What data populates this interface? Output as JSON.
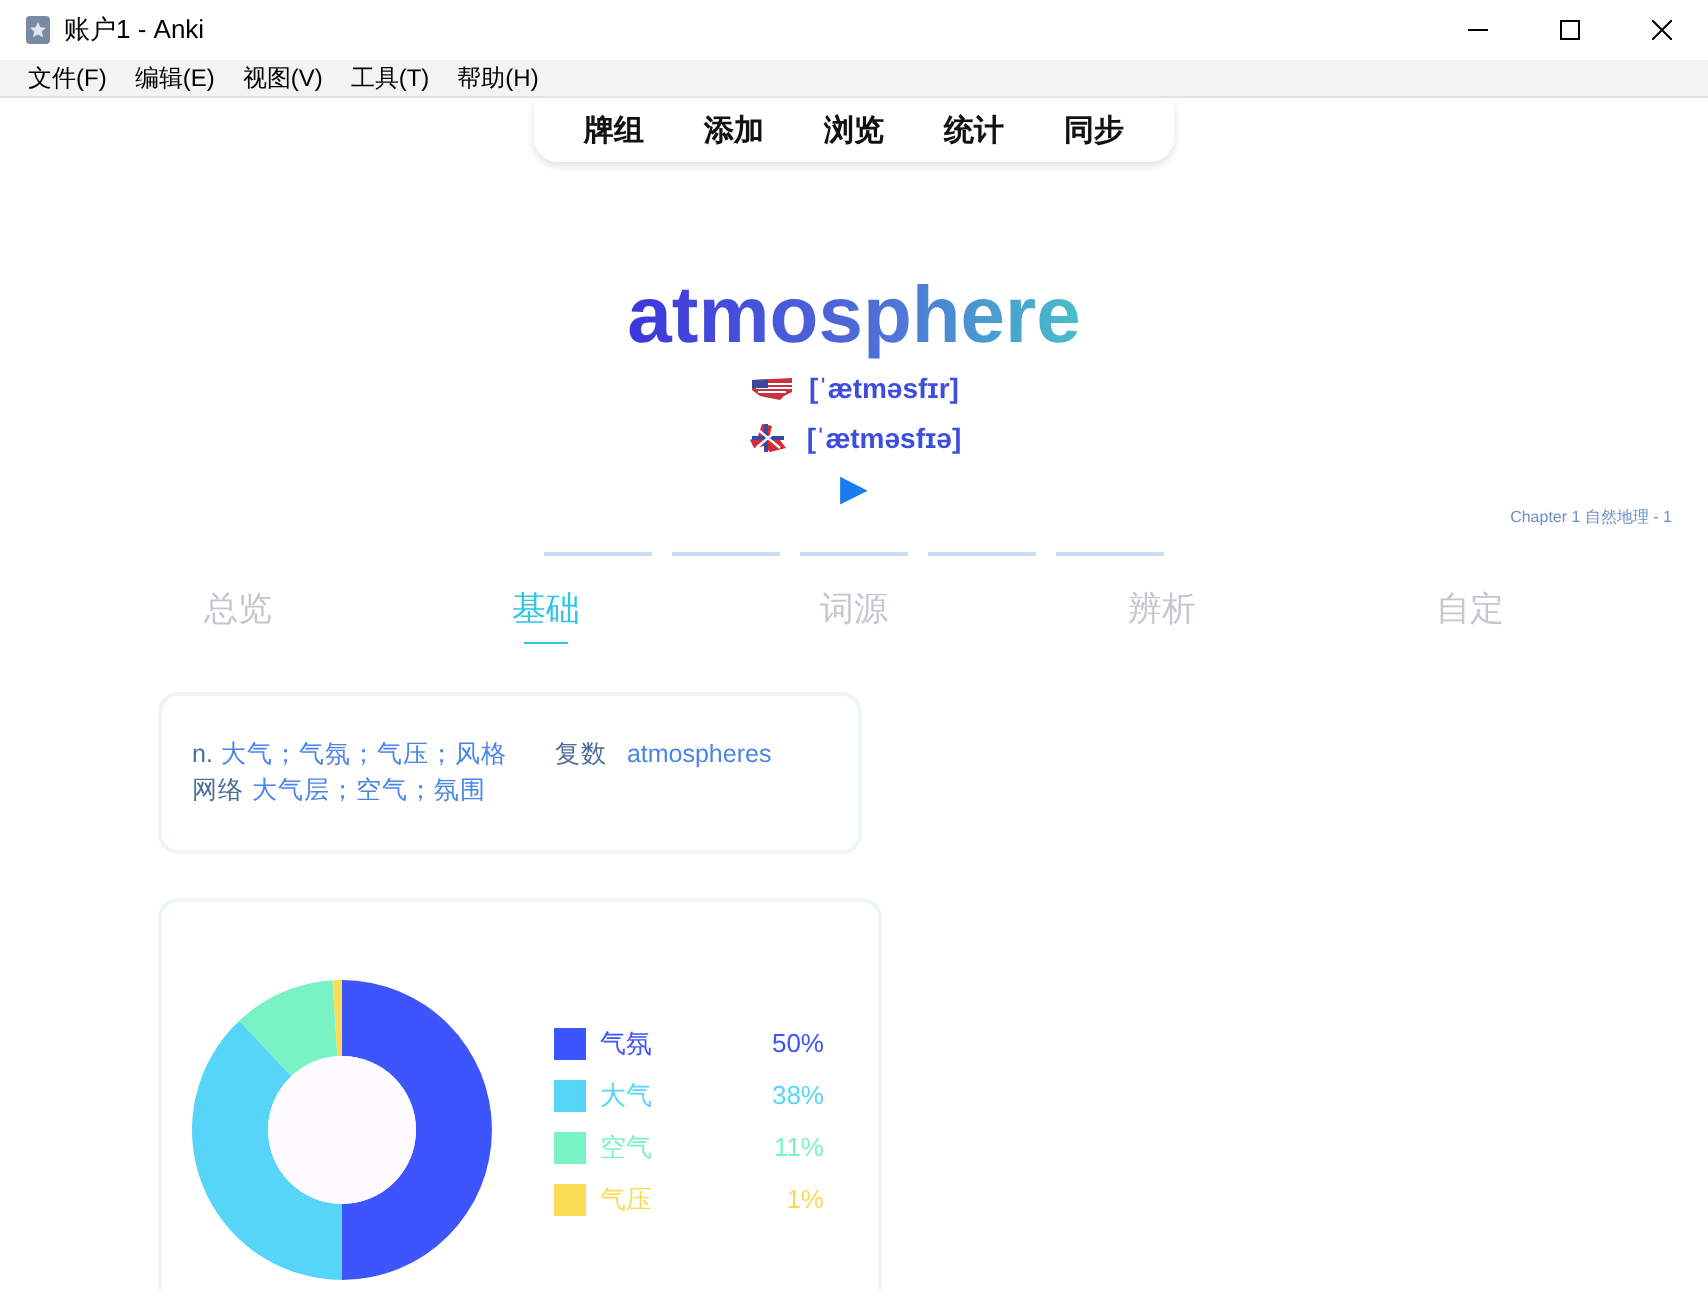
{
  "window": {
    "title": "账户1 - Anki"
  },
  "menu": [
    "文件(F)",
    "编辑(E)",
    "视图(V)",
    "工具(T)",
    "帮助(H)"
  ],
  "nav": [
    "牌组",
    "添加",
    "浏览",
    "统计",
    "同步"
  ],
  "word": "atmosphere",
  "pronunciations": [
    {
      "kind": "us",
      "phonetic": "[ˈætməsfɪr]"
    },
    {
      "kind": "uk",
      "phonetic": "[ˈætməsfɪə]"
    }
  ],
  "play_button": "▶",
  "chapter": "Chapter 1 自然地理 - 1",
  "tabs": [
    {
      "label": "总览",
      "selected": false
    },
    {
      "label": "基础",
      "selected": true
    },
    {
      "label": "词源",
      "selected": false
    },
    {
      "label": "辨析",
      "selected": false
    },
    {
      "label": "自定",
      "selected": false
    }
  ],
  "definition": {
    "part": "n.",
    "meanings": "大气；气氛；气压；风格",
    "plural_label": "复数",
    "plural": "atmospheres",
    "web_label": "网络",
    "web": "大气层；空气；氛围"
  },
  "chart": {
    "chart_data": {
      "type": "donut",
      "categories": [
        "气氛",
        "大气",
        "空气",
        "气压"
      ],
      "values": [
        50,
        38,
        11,
        1
      ]
    },
    "legend": [
      {
        "percent": "50%",
        "color": "#3d55fd"
      },
      {
        "percent": "38%",
        "color": "#57d5f9"
      },
      {
        "percent": "11%",
        "color": "#7af3c4"
      },
      {
        "percent": "1%",
        "color": "#fadc55"
      }
    ]
  }
}
